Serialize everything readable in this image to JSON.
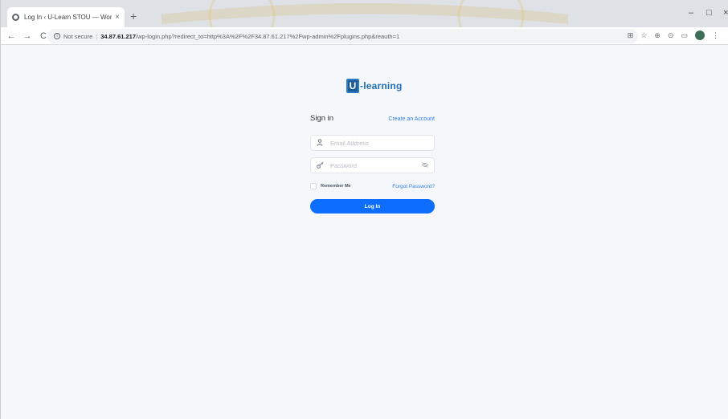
{
  "browser": {
    "tab_title": "Log In ‹ U-Learn STOU — WordPress",
    "tab_close": "×",
    "new_tab": "+",
    "window_controls": {
      "minimize": "–",
      "maximize": "□",
      "close": "×"
    },
    "nav": {
      "back": "←",
      "forward": "→",
      "reload": "C"
    },
    "address": {
      "security_label": "Not secure",
      "host": "34.87.61.217",
      "path": "/wp-login.php?redirect_to=http%3A%2F%2F34.87.61.217%2Fwp-admin%2Fplugins.php&reauth=1"
    },
    "toolbar_icons": [
      "translate-icon",
      "star-icon",
      "extension-icon",
      "extension-icon",
      "cast-icon",
      "profile-avatar",
      "menu-icon"
    ]
  },
  "page": {
    "logo": {
      "mark": "U",
      "text": "-learning"
    },
    "signin_title": "Sign in",
    "create_account": "Create an Account",
    "email_placeholder": "Email Address",
    "password_placeholder": "Password",
    "remember_label": "Remember Me",
    "forgot_label": "Forgot Password?",
    "login_label": "Log In"
  },
  "colors": {
    "accent": "#0d6efd",
    "link": "#2f80ed",
    "logo": "#1e6fb8",
    "watermark": "#d4a017"
  }
}
